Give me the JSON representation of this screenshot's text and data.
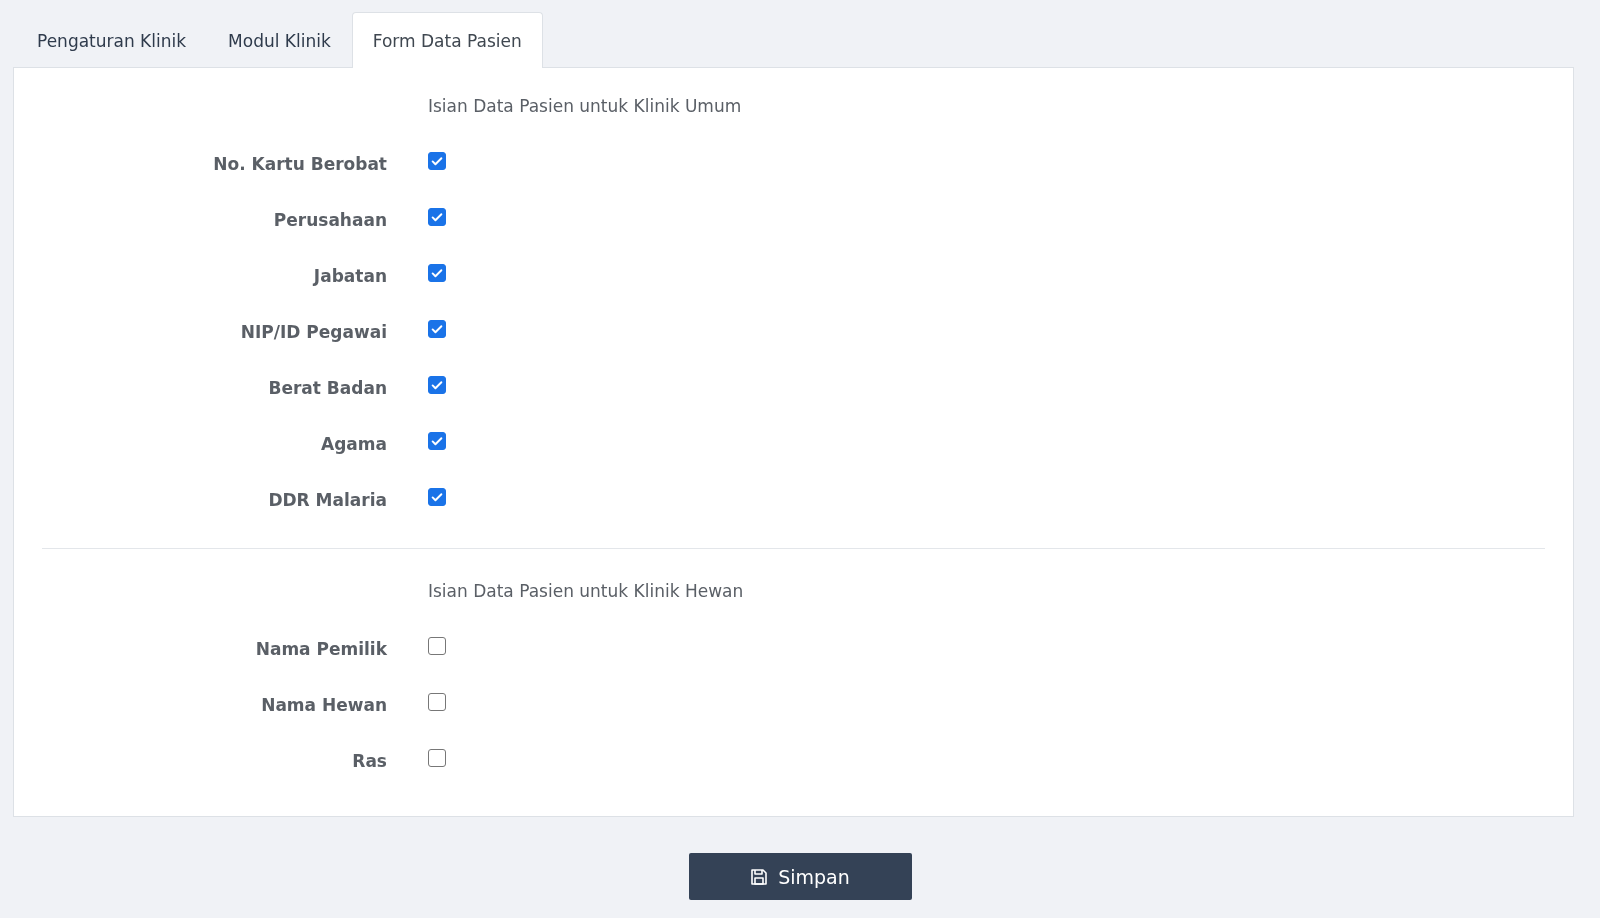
{
  "tabs": [
    {
      "label": "Pengaturan Klinik",
      "selected": false
    },
    {
      "label": "Modul Klinik",
      "selected": false
    },
    {
      "label": "Form Data Pasien",
      "selected": true
    }
  ],
  "sections": [
    {
      "heading": "Isian Data Pasien untuk Klinik Umum",
      "fields": [
        {
          "label": "No. Kartu Berobat",
          "checked": true
        },
        {
          "label": "Perusahaan",
          "checked": true
        },
        {
          "label": "Jabatan",
          "checked": true
        },
        {
          "label": "NIP/ID Pegawai",
          "checked": true
        },
        {
          "label": "Berat Badan",
          "checked": true
        },
        {
          "label": "Agama",
          "checked": true
        },
        {
          "label": "DDR Malaria",
          "checked": true
        }
      ]
    },
    {
      "heading": "Isian Data Pasien untuk Klinik Hewan",
      "fields": [
        {
          "label": "Nama Pemilik",
          "checked": false
        },
        {
          "label": "Nama Hewan",
          "checked": false
        },
        {
          "label": "Ras",
          "checked": false
        }
      ]
    }
  ],
  "save_button": {
    "label": "Simpan"
  }
}
